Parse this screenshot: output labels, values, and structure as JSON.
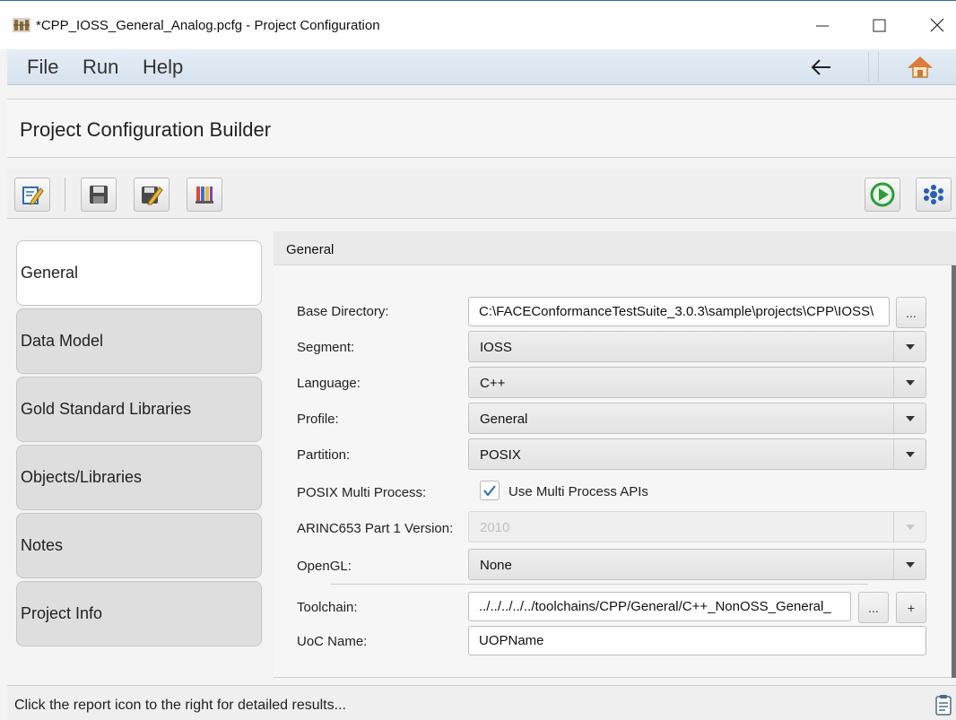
{
  "window": {
    "title": "*CPP_IOSS_General_Analog.pcfg - Project Configuration",
    "app_icon": "face-logo-icon",
    "controls": [
      "minimize-icon",
      "maximize-icon",
      "close-icon"
    ]
  },
  "menu": {
    "file": "File",
    "run": "Run",
    "help": "Help",
    "back_icon": "arrow-left-icon",
    "home_icon": "home-icon"
  },
  "header": {
    "title": "Project Configuration Builder"
  },
  "toolbar": {
    "buttons": [
      "edit-icon",
      "save-icon",
      "save-as-icon",
      "library-icon",
      "run-icon",
      "config-icon"
    ],
    "run_color": "#2e9b3a",
    "accent": "#2b6cb0"
  },
  "sidebar": {
    "tabs": [
      {
        "label": "General",
        "active": true
      },
      {
        "label": "Data Model"
      },
      {
        "label": "Gold Standard Libraries"
      },
      {
        "label": "Objects/Libraries"
      },
      {
        "label": "Notes"
      },
      {
        "label": "Project Info"
      }
    ]
  },
  "panel": {
    "title": "General",
    "base_directory": {
      "label": "Base Directory:",
      "value": "C:\\FACEConformanceTestSuite_3.0.3\\sample\\projects\\CPP\\IOSS\\",
      "browse": "..."
    },
    "segment": {
      "label": "Segment:",
      "value": "IOSS"
    },
    "language": {
      "label": "Language:",
      "value": "C++"
    },
    "profile": {
      "label": "Profile:",
      "value": "General"
    },
    "partition": {
      "label": "Partition:",
      "value": "POSIX"
    },
    "posix_multi": {
      "label": "POSIX Multi Process:",
      "checkbox_label": "Use Multi Process APIs",
      "checked": true
    },
    "arinc": {
      "label": "ARINC653 Part 1 Version:",
      "value": "2010",
      "disabled": true
    },
    "opengl": {
      "label": "OpenGL:",
      "value": "None"
    },
    "toolchain": {
      "label": "Toolchain:",
      "value": "../../../../../toolchains/CPP/General/C++_NonOSS_General_",
      "browse": "...",
      "add": "+"
    },
    "uoc_name": {
      "label": "UoC Name:",
      "value": "UOPName"
    }
  },
  "status": {
    "message": "Click the report icon to the right for detailed results...",
    "report_icon": "report-icon"
  }
}
